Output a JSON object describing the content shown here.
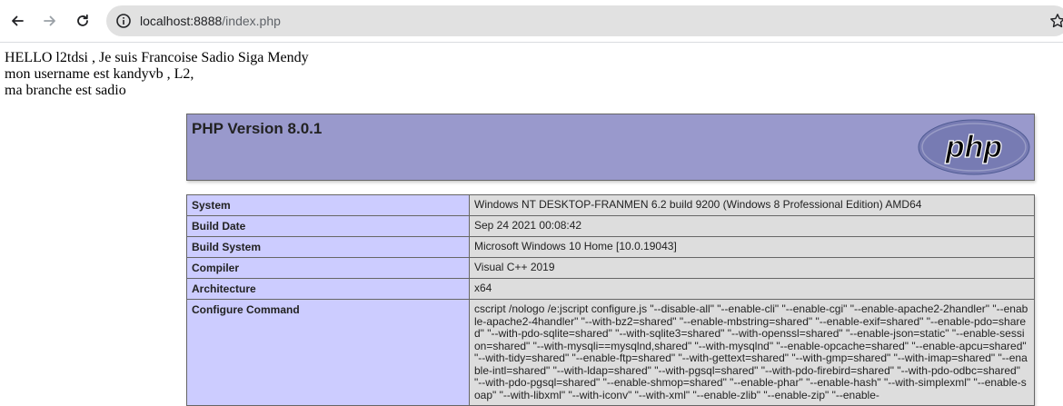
{
  "browser": {
    "url_host": "localhost:8888",
    "url_path": "/index.php",
    "icons": [
      "back-arrow-icon",
      "forward-arrow-icon",
      "reload-icon",
      "info-icon",
      "star-icon"
    ]
  },
  "greeting": {
    "line1": "HELLO l2tdsi , Je suis Francoise Sadio Siga Mendy",
    "line2": "mon username est kandyvb , L2,",
    "line3": "ma branche est sadio"
  },
  "php_header": {
    "title": "PHP Version 8.0.1",
    "logo_text": "php",
    "colors": {
      "header_bg": "#9999cc",
      "label_bg": "#ccccff",
      "value_bg": "#dddddd"
    }
  },
  "info_rows": [
    {
      "label": "System",
      "value": "Windows NT DESKTOP-FRANMEN 6.2 build 9200 (Windows 8 Professional Edition) AMD64"
    },
    {
      "label": "Build Date",
      "value": "Sep 24 2021 00:08:42"
    },
    {
      "label": "Build System",
      "value": "Microsoft Windows 10 Home [10.0.19043]"
    },
    {
      "label": "Compiler",
      "value": "Visual C++ 2019"
    },
    {
      "label": "Architecture",
      "value": "x64"
    },
    {
      "label": "Configure Command",
      "value": "cscript /nologo /e:jscript configure.js \"--disable-all\" \"--enable-cli\" \"--enable-cgi\" \"--enable-apache2-2handler\" \"--enable-apache2-4handler\" \"--with-bz2=shared\" \"--enable-mbstring=shared\" \"--enable-exif=shared\" \"--enable-pdo=shared\" \"--with-pdo-sqlite=shared\" \"--with-sqlite3=shared\" \"--with-openssl=shared\" \"--enable-json=static\" \"--enable-session=shared\" \"--with-mysqli==mysqlnd,shared\" \"--with-mysqlnd\" \"--enable-opcache=shared\" \"--enable-apcu=shared\" \"--with-tidy=shared\" \"--enable-ftp=shared\" \"--with-gettext=shared\" \"--with-gmp=shared\" \"--with-imap=shared\" \"--enable-intl=shared\" \"--with-ldap=shared\" \"--with-pgsql=shared\" \"--with-pdo-firebird=shared\" \"--with-pdo-odbc=shared\" \"--with-pdo-pgsql=shared\" \"--enable-shmop=shared\" \"--enable-phar\" \"--enable-hash\" \"--with-simplexml\" \"--enable-soap\" \"--with-libxml\" \"--with-iconv\" \"--with-xml\" \"--enable-zlib\" \"--enable-zip\" \"--enable-"
    }
  ]
}
